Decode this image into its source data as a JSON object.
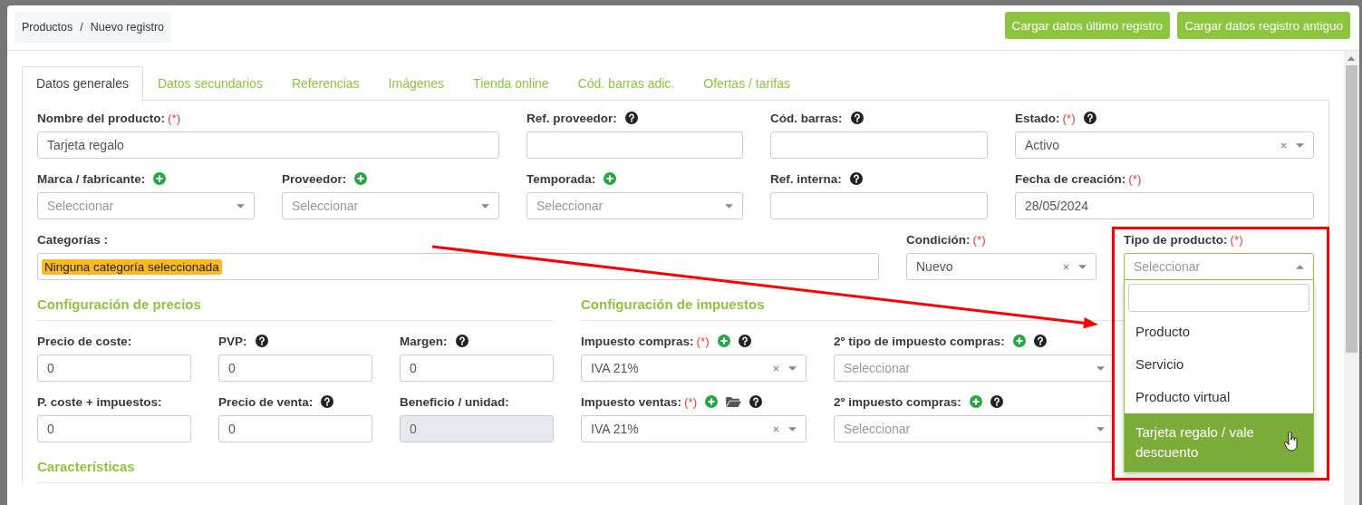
{
  "breadcrumb": {
    "items": [
      "Productos",
      "Nuevo registro"
    ],
    "separator": "/"
  },
  "header_buttons": [
    "Cargar datos último registro",
    "Cargar datos registro antiguo"
  ],
  "tabs": [
    {
      "label": "Datos generales",
      "selected": true
    },
    {
      "label": "Datos secundarios",
      "selected": false
    },
    {
      "label": "Referencias",
      "selected": false
    },
    {
      "label": "Imágenes",
      "selected": false
    },
    {
      "label": "Tienda online",
      "selected": false
    },
    {
      "label": "Cód. barras adic.",
      "selected": false
    },
    {
      "label": "Ofertas / tarifas",
      "selected": false
    }
  ],
  "general": {
    "rows": [
      {
        "fields": [
          {
            "label": "Nombre del producto:",
            "required_mark": "(*)",
            "add": false,
            "folder": false,
            "help": false,
            "kind": "text",
            "value": "Tarjeta regalo",
            "disabled": false
          },
          {
            "label": "Ref. proveedor:",
            "add": false,
            "folder": false,
            "help": true,
            "kind": "text",
            "disabled": false
          },
          {
            "label": "Cód. barras:",
            "add": false,
            "folder": false,
            "help": true,
            "kind": "text",
            "disabled": false
          },
          {
            "label": "Estado:",
            "required_mark": "(*)",
            "add": false,
            "folder": false,
            "help": true,
            "kind": "select",
            "value": "Activo",
            "clearable": true,
            "open": false
          }
        ]
      },
      {
        "fields": [
          {
            "label": "Marca / fabricante:",
            "add": true,
            "folder": false,
            "help": false,
            "kind": "select",
            "placeholder": "Seleccionar",
            "clearable": false,
            "open": false
          },
          {
            "label": "Proveedor:",
            "add": true,
            "folder": false,
            "help": false,
            "kind": "select",
            "placeholder": "Seleccionar",
            "clearable": false,
            "open": false
          },
          {
            "label": "Temporada:",
            "add": true,
            "folder": false,
            "help": false,
            "kind": "select",
            "placeholder": "Seleccionar",
            "clearable": false,
            "open": false
          },
          {
            "label": "Ref. interna:",
            "add": false,
            "folder": false,
            "help": true,
            "kind": "text",
            "disabled": false
          },
          {
            "label": "Fecha de creación:",
            "required_mark": "(*)",
            "add": false,
            "folder": false,
            "help": false,
            "kind": "text",
            "value": "28/05/2024",
            "disabled": false
          }
        ]
      },
      {
        "fields": [
          {
            "label": "Categorías :",
            "add": false,
            "folder": false,
            "help": false,
            "kind": "tags",
            "tags": [
              "Ninguna categoría seleccionada"
            ]
          },
          {
            "label": "Condición:",
            "required_mark": "(*)",
            "add": false,
            "folder": false,
            "help": false,
            "kind": "select",
            "value": "Nuevo",
            "clearable": true,
            "open": false
          },
          {
            "label": "Tipo de producto:",
            "required_mark": "(*)",
            "add": false,
            "folder": false,
            "help": false,
            "kind": "select",
            "placeholder": "Seleccionar",
            "clearable": false,
            "open": true,
            "options": [
              {
                "label": "Producto",
                "selected": false
              },
              {
                "label": "Servicio",
                "selected": false
              },
              {
                "label": "Producto virtual",
                "selected": false
              },
              {
                "label": "Tarjeta regalo / vale descuento",
                "selected": true
              }
            ]
          }
        ]
      }
    ]
  },
  "pricing": {
    "title": "Configuración de precios",
    "fields": [
      {
        "label": "Precio de coste:",
        "add": false,
        "folder": false,
        "help": false,
        "kind": "text",
        "value": "0",
        "disabled": false
      },
      {
        "label": "PVP:",
        "add": false,
        "folder": false,
        "help": true,
        "kind": "text",
        "value": "0",
        "disabled": false
      },
      {
        "label": "Margen:",
        "add": false,
        "folder": false,
        "help": true,
        "kind": "text",
        "value": "0",
        "disabled": false
      },
      {
        "label": "P. coste + impuestos:",
        "add": false,
        "folder": false,
        "help": false,
        "kind": "text",
        "value": "0",
        "disabled": false
      },
      {
        "label": "Precio de venta:",
        "add": false,
        "folder": false,
        "help": true,
        "kind": "text",
        "value": "0",
        "disabled": false
      },
      {
        "label": "Beneficio / unidad:",
        "add": false,
        "folder": false,
        "help": false,
        "kind": "text",
        "value": "0",
        "disabled": true
      }
    ]
  },
  "taxes": {
    "title": "Configuración de impuestos",
    "fields": [
      {
        "label": "Impuesto compras:",
        "required_mark": "(*)",
        "add": true,
        "folder": false,
        "help": true,
        "kind": "select",
        "value": "IVA 21%",
        "clearable": true,
        "open": false
      },
      {
        "label": "2º tipo de impuesto compras:",
        "add": true,
        "folder": false,
        "help": true,
        "kind": "select",
        "placeholder": "Seleccionar",
        "clearable": false,
        "open": false
      },
      {
        "label": "Impuesto ventas:",
        "required_mark": "(*)",
        "add": true,
        "folder": true,
        "help": true,
        "kind": "select",
        "value": "IVA 21%",
        "clearable": true,
        "open": false
      },
      {
        "label": "2º impuesto compras:",
        "add": true,
        "folder": false,
        "help": true,
        "kind": "select",
        "placeholder": "Seleccionar",
        "clearable": false,
        "open": false
      }
    ]
  },
  "features": {
    "title": "Características"
  }
}
